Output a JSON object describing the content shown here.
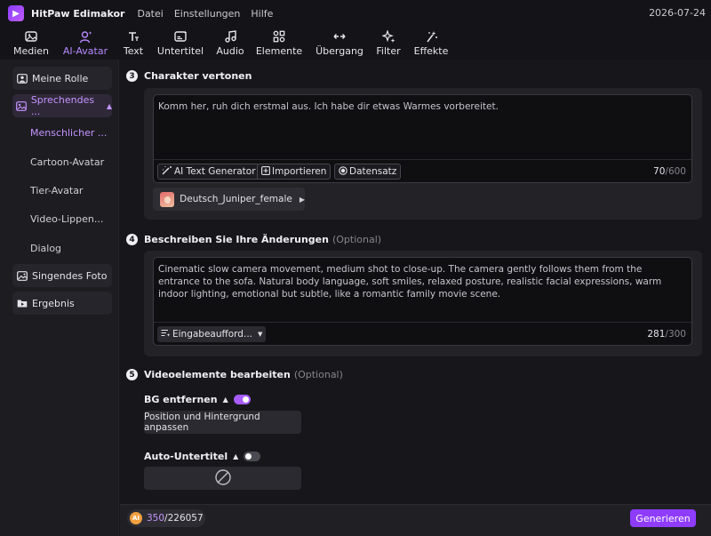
{
  "app": {
    "name": "HitPaw Edimakor",
    "date": "2026-07-24",
    "logo_letter": "▶"
  },
  "menu": [
    "Datei",
    "Einstellungen",
    "Hilfe"
  ],
  "toolbar": [
    {
      "label": "Medien",
      "icon": "media-icon"
    },
    {
      "label": "AI-Avatar",
      "icon": "ai-avatar-icon",
      "active": true
    },
    {
      "label": "Text",
      "icon": "text-icon"
    },
    {
      "label": "Untertitel",
      "icon": "subtitle-icon"
    },
    {
      "label": "Audio",
      "icon": "audio-icon"
    },
    {
      "label": "Elemente",
      "icon": "elements-icon"
    },
    {
      "label": "Übergang",
      "icon": "transition-icon"
    },
    {
      "label": "Filter",
      "icon": "filter-icon"
    },
    {
      "label": "Effekte",
      "icon": "effects-icon"
    }
  ],
  "sidebar": {
    "items": [
      {
        "label": "Meine Rolle"
      },
      {
        "label": "Sprechendes ..."
      },
      {
        "label": "Singendes Foto"
      },
      {
        "label": "Ergebnis"
      }
    ],
    "sub_items": [
      {
        "label": "Menschlicher ..."
      },
      {
        "label": "Cartoon-Avatar"
      },
      {
        "label": "Tier-Avatar"
      },
      {
        "label": "Video-Lippen..."
      },
      {
        "label": "Dialog"
      }
    ]
  },
  "section3": {
    "step": "3",
    "title": "Charakter vertonen",
    "text": "Komm her, ruh dich erstmal aus. Ich habe dir etwas Warmes vorbereitet.",
    "buttons": [
      "AI Text Generator",
      "Importieren",
      "Datensatz"
    ],
    "count": "70",
    "max": "/600",
    "voice": "Deutsch_Juniper_female"
  },
  "section4": {
    "step": "4",
    "title": "Beschreiben Sie Ihre Änderungen",
    "optional": "(Optional)",
    "text": "Cinematic slow camera movement, medium shot to close-up. The camera gently follows them from the entrance to the sofa. Natural body language, soft smiles, relaxed posture, realistic facial expressions, warm indoor lighting, emotional but subtle, like a romantic family movie scene.",
    "prompt_select": "Eingabeaufford...",
    "count": "281",
    "max": "/300"
  },
  "section5": {
    "step": "5",
    "title": "Videoelemente bearbeiten",
    "optional": "(Optional)",
    "bg_label": "BG entfernen",
    "bg_enabled": true,
    "bg_button": "Position und Hintergrund anpassen",
    "subtitle_label": "Auto-Untertitel",
    "subtitle_enabled": false
  },
  "bottom": {
    "coin": "AI",
    "credits_used": "350",
    "credits_total": "/226057",
    "generate": "Generieren"
  },
  "colors": {
    "accent": "#a65cff",
    "background": "#17171b",
    "panel": "#222227"
  }
}
